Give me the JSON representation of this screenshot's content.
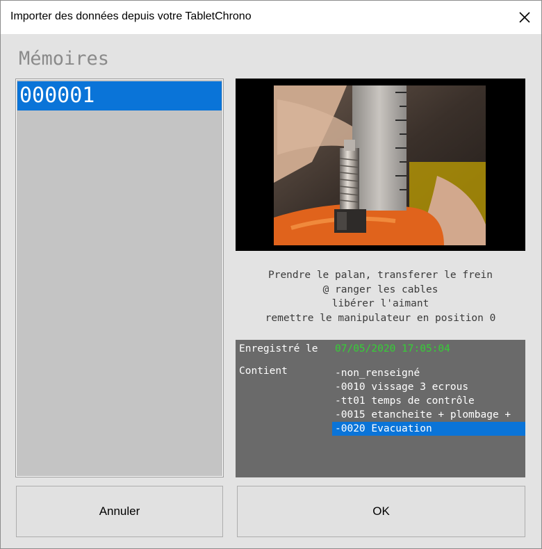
{
  "window": {
    "title": "Importer des données depuis votre TabletChrono",
    "close_icon": "close-icon"
  },
  "memories": {
    "label": "Mémoires",
    "items": [
      "000001"
    ],
    "selected_index": 0
  },
  "photo": {
    "icon": "photo-of-threaded-bolt-with-ruler"
  },
  "description": {
    "lines": [
      "Prendre le palan, transferer le frein",
      "@ ranger les cables",
      "libérer l'aimant",
      "remettre le manipulateur en position 0"
    ]
  },
  "info": {
    "registered_label": "Enregistré le",
    "registered_value": "07/05/2020 17:05:04",
    "contains_label": "Contient",
    "operations": [
      "-non_renseigné",
      "-0010 vissage 3 ecrous",
      "-tt01 temps de contrôle",
      "-0015 etancheite + plombage +",
      "-0020 Evacuation"
    ],
    "selected_operation_index": 4
  },
  "buttons": {
    "cancel": "Annuler",
    "ok": "OK"
  },
  "colors": {
    "selection": "#0a74d8",
    "date_green": "#35d035",
    "info_panel_bg": "#6a6a6a",
    "list_bg": "#c4c4c4"
  }
}
